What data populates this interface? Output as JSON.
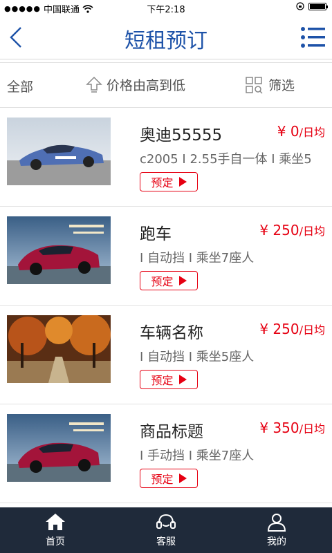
{
  "status": {
    "carrier": "中国联通",
    "time": "下午2:18"
  },
  "header": {
    "title": "短租预订"
  },
  "filters": {
    "all": "全部",
    "sort": "价格由高到低",
    "filter": "筛选"
  },
  "cars": [
    {
      "name": "奥迪55555",
      "price": "¥ 0",
      "unit": "/日均",
      "spec": "c2005 I 2.55手自一体 I 乘坐5",
      "book": "预定"
    },
    {
      "name": "跑车",
      "price": "¥ 250",
      "unit": "/日均",
      "spec": "I 自动挡 I 乘坐7座人",
      "book": "预定"
    },
    {
      "name": "车辆名称",
      "price": "¥ 250",
      "unit": "/日均",
      "spec": "I 自动挡 I 乘坐5座人",
      "book": "预定"
    },
    {
      "name": "商品标题",
      "price": "¥ 350",
      "unit": "/日均",
      "spec": "I 手动挡 I 乘坐7座人",
      "book": "预定"
    }
  ],
  "tabs": {
    "home": "首页",
    "service": "客服",
    "mine": "我的"
  },
  "colors": {
    "accent": "#1d52a8",
    "price": "#e60012",
    "tabbar": "#1f2a3a"
  }
}
